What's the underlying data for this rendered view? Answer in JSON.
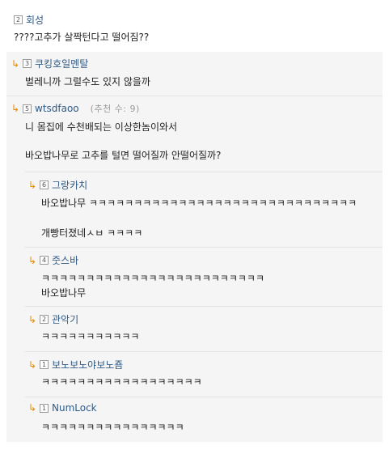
{
  "comments": [
    {
      "level": "2",
      "nick": "회성",
      "body": "????고추가 살짝턴다고 떨어짐??"
    },
    {
      "level": "3",
      "nick": "쿠킹호일멘탈",
      "body": "벌레니까 그럴수도 있지 않을까"
    },
    {
      "level": "5",
      "nick": "wtsdfaoo",
      "vote": "(추천 수: 9)",
      "body1": "니 몸집에 수천배되는 이상한놈이와서",
      "body2": "바오밥나무로 고추를 털면 떨어질까 안떨어질까?"
    },
    {
      "level": "6",
      "nick": "그랑카치",
      "body1": "바오밥나무 ㅋㅋㅋㅋㅋㅋㅋㅋㅋㅋㅋㅋㅋㅋㅋㅋㅋㅋㅋㅋㅋㅋㅋㅋㅋㅋㅋㅋㅋㅋ",
      "body2": "개빵터졌네ㅅㅂ ㅋㅋㅋㅋ"
    },
    {
      "level": "4",
      "nick": "줏스바",
      "body1": "ㅋㅋㅋㅋㅋㅋㅋㅋㅋㅋㅋㅋㅋㅋㅋㅋㅋㅋㅋㅋㅋㅋㅋㅋㅋ",
      "body2": "바오밥나무"
    },
    {
      "level": "2",
      "nick": "관악기",
      "body": "ㅋㅋㅋㅋㅋㅋㅋㅋㅋㅋㅋ"
    },
    {
      "level": "1",
      "nick": "보노보노야보노죰",
      "body": "ㅋㅋㅋㅋㅋㅋㅋㅋㅋㅋㅋㅋㅋㅋㅋㅋㅋㅋ"
    },
    {
      "level": "1",
      "nick": "NumLock",
      "body": "ㅋㅋㅋㅋㅋㅋㅋㅋㅋㅋㅋㅋㅋㅋㅋㅋ"
    }
  ],
  "reply_arrow": "↳",
  "colors": {
    "nick": "#2f5a86",
    "arrow": "#e98b00",
    "panel": "#f5f5f5"
  }
}
